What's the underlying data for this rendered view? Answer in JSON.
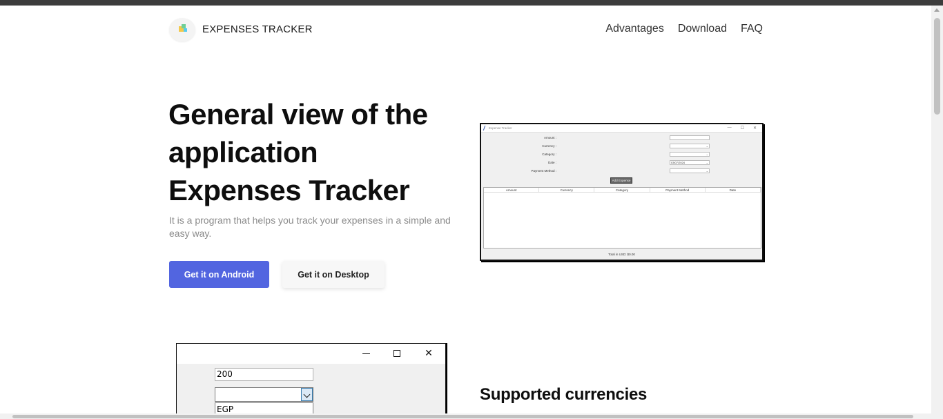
{
  "header": {
    "brand": "EXPENSES TRACKER",
    "nav": [
      "Advantages",
      "Download",
      "FAQ"
    ]
  },
  "hero": {
    "title_lines": [
      "General view of the",
      "application",
      "Expenses Tracker"
    ],
    "subtitle": "It is a program that helps you track your expenses in a simple and easy way.",
    "btn_android": "Get it on Android",
    "btn_desktop": "Get it on Desktop"
  },
  "preview1": {
    "window_title": "Expense Tracker",
    "controls": [
      "—",
      "☐",
      "✕"
    ],
    "labels": [
      "Amount :",
      "Currency :",
      "Category :",
      "Date :",
      "Payment Method :"
    ],
    "date_value": "03/07/2024",
    "add_button": "Add Expense",
    "columns": [
      "Amount",
      "Currency",
      "Category",
      "Payment Method",
      "Date"
    ],
    "total": "Total in USD: $0.00"
  },
  "preview2": {
    "amount_value": "200",
    "option": "EGP"
  },
  "section2": {
    "title": "Supported currencies"
  },
  "colors": {
    "primary": "#5265e0",
    "text_dark": "#0e0e0e",
    "text_muted": "#8a8a8a"
  }
}
